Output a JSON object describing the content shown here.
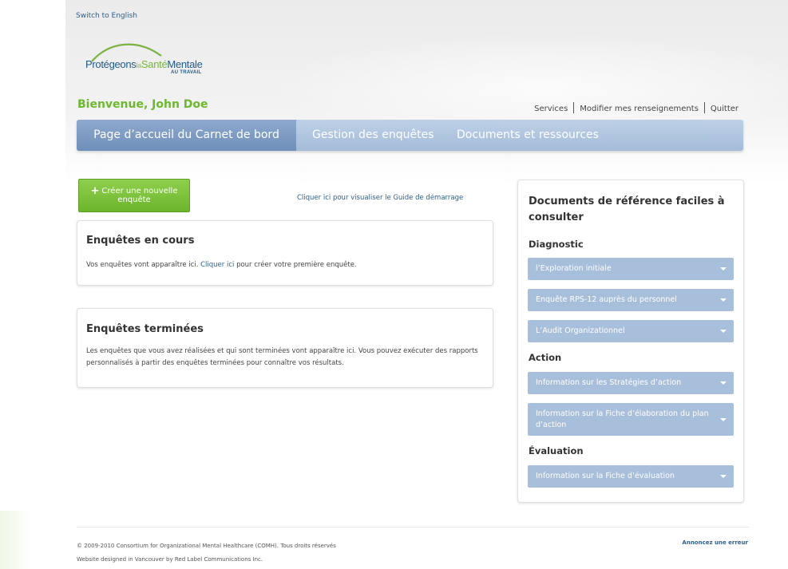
{
  "header": {
    "switch_lang": "Switch to English",
    "logo": {
      "part1": "Protégeons",
      "part2": "la",
      "part3": "Santé",
      "part4": "Mentale",
      "sub": "AU TRAVAIL"
    },
    "welcome": "Bienvenue, John Doe",
    "user_links": [
      "Services",
      "Modifier mes renseignements",
      "Quitter"
    ]
  },
  "nav": {
    "tabs": [
      {
        "label": "Page d’accueil du Carnet de bord",
        "active": true
      },
      {
        "label": "Gestion des enquêtes",
        "active": false
      },
      {
        "label": "Documents et ressources",
        "active": false
      }
    ]
  },
  "main": {
    "create_button": {
      "icon": "plus-icon",
      "label_line1": "Créer une nouvelle",
      "label_line2": "enquête"
    },
    "guide_link": "Cliquer ici pour visualiser le Guide de démarrage",
    "current": {
      "title": "Enquêtes en cours",
      "text_before": "Vos enquêtes vont apparaître ici. ",
      "link": "Cliquer ici",
      "text_after": " pour créer votre première enquête."
    },
    "done": {
      "title": "Enquêtes terminées",
      "text": "Les enquêtes que vous avez réalisées et qui sont terminées vont apparaître ici. Vous pouvez exécuter des rapports personnalisés à partir des enquêtes terminées pour connaître vos résultats."
    }
  },
  "sidebar": {
    "title": "Documents de référence faciles à consulter",
    "sections": [
      {
        "title": "Diagnostic",
        "items": [
          "l’Exploration initiale",
          "Enquête RPS-12 auprès du personnel",
          "L’Audit Organizationnel"
        ]
      },
      {
        "title": "Action",
        "items": [
          "Information sur les Stratégies d’action",
          "Information sur la Fiche d’élaboration du plan d’action"
        ]
      },
      {
        "title": "Évaluation",
        "items": [
          "Information sur la Fiche d’évaluation"
        ]
      }
    ]
  },
  "footer": {
    "copyright": "© 2009-2010 Consortium for Organizational Mental Healthcare (COMH). Tous droits réservés",
    "designed": "Website designed in Vancouver by Red Label Communications Inc.",
    "report": "Annoncez une erreur"
  },
  "colors": {
    "accent_green": "#6cb82e",
    "nav_blue": "#a4bcd9",
    "nav_active": "#6f8fb9",
    "link_blue": "#2d5f8f",
    "sidebar_item": "#a8bfdb"
  }
}
